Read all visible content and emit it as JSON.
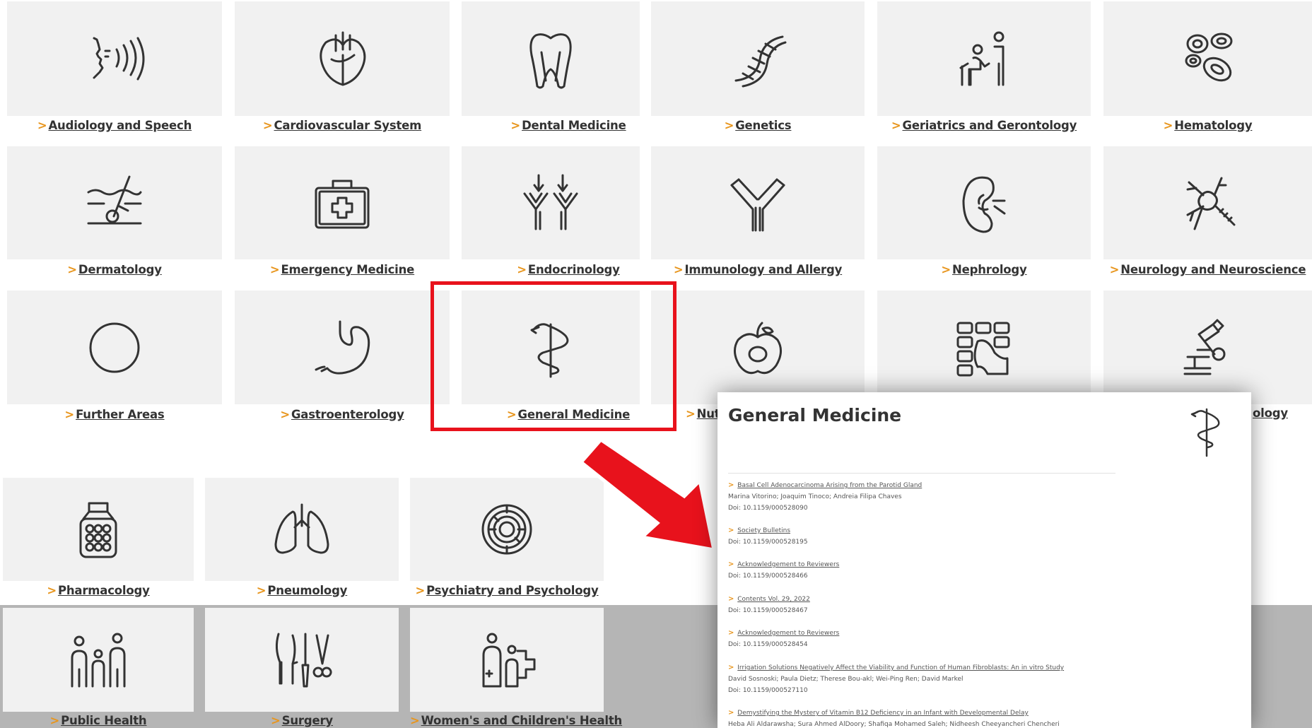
{
  "tiles": [
    {
      "label": "Audiology and Speech",
      "icon": "speech-icon"
    },
    {
      "label": "Cardiovascular System",
      "icon": "heart-icon"
    },
    {
      "label": "Dental Medicine",
      "icon": "tooth-icon"
    },
    {
      "label": "Genetics",
      "icon": "dna-icon"
    },
    {
      "label": "Geriatrics and Gerontology",
      "icon": "elderly-icon"
    },
    {
      "label": "Hematology",
      "icon": "blood-cells-icon"
    },
    {
      "label": "Dermatology",
      "icon": "skin-icon"
    },
    {
      "label": "Emergency Medicine",
      "icon": "first-aid-kit-icon"
    },
    {
      "label": "Endocrinology",
      "icon": "receptor-icon"
    },
    {
      "label": "Immunology and Allergy",
      "icon": "antibody-icon"
    },
    {
      "label": "Nephrology",
      "icon": "kidney-icon"
    },
    {
      "label": "Neurology and Neuroscience",
      "icon": "neuron-icon"
    },
    {
      "label": "Further Areas",
      "icon": "circle-icon"
    },
    {
      "label": "Gastroenterology",
      "icon": "stomach-icon"
    },
    {
      "label": "General Medicine",
      "icon": "caduceus-icon"
    },
    {
      "label": "Nut",
      "icon": "apple-icon"
    },
    {
      "label": "",
      "icon": "cells-icon"
    },
    {
      "label": "ology",
      "icon": "microscope-icon"
    },
    {
      "label": "Pharmacology",
      "icon": "pill-jar-icon"
    },
    {
      "label": "Pneumology",
      "icon": "lungs-icon"
    },
    {
      "label": "Psychiatry and Psychology",
      "icon": "maze-icon"
    },
    {
      "label": "Public Health",
      "icon": "people-icon"
    },
    {
      "label": "Surgery",
      "icon": "surgical-tools-icon"
    },
    {
      "label": "Women's and Children's Health",
      "icon": "mother-child-icon"
    }
  ],
  "popup": {
    "title": "General Medicine",
    "articles": [
      {
        "title": "Basal Cell Adenocarcinoma Arising from the Parotid Gland",
        "authors": "Marina Vitorino; Joaquim Tinoco; Andreia Filipa Chaves",
        "doi": "Doi: 10.1159/000528090"
      },
      {
        "title": "Society Bulletins",
        "authors": "",
        "doi": "Doi: 10.1159/000528195"
      },
      {
        "title": "Acknowledgement to Reviewers",
        "authors": "",
        "doi": "Doi: 10.1159/000528466"
      },
      {
        "title": "Contents Vol. 29, 2022",
        "authors": "",
        "doi": "Doi: 10.1159/000528467"
      },
      {
        "title": "Acknowledgement to Reviewers",
        "authors": "",
        "doi": "Doi: 10.1159/000528454"
      },
      {
        "title": "Irrigation Solutions Negatively Affect the Viability and Function of Human Fibroblasts: An in vitro Study",
        "authors": "David Sosnoski; Paula Dietz; Therese Bou-akl; Wei-Ping Ren; David Markel",
        "doi": "Doi: 10.1159/000527110"
      },
      {
        "title": "Demystifying the Mystery of Vitamin B12 Deficiency in an Infant with Developmental Delay",
        "authors": "Heba Ali Aldarawsha; Sura Ahmed AlDoory; Shafiqa Mohamed Saleh; Nidheesh Cheeyancheri Chencheri",
        "doi": ""
      }
    ]
  },
  "colors": {
    "chevron": "#e8961e",
    "highlight": "#e8121c",
    "tile": "#f1f1f1"
  }
}
